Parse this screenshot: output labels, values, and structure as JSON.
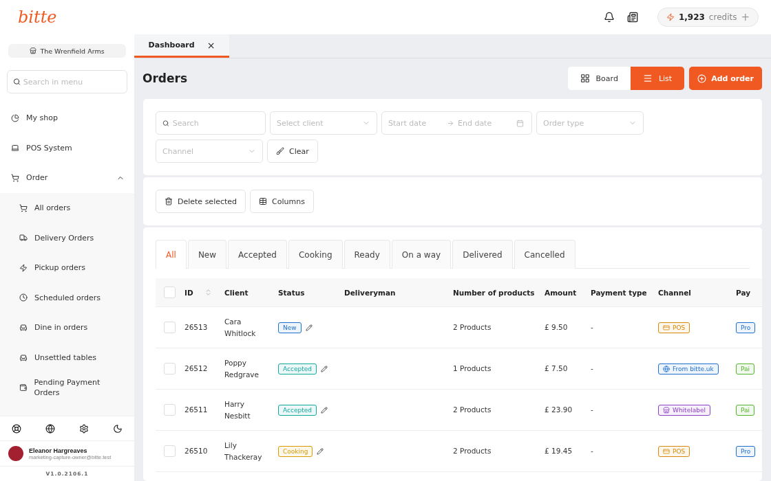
{
  "logo": "bitte",
  "shop": "The Wrenfield Arms",
  "menu_search": {
    "placeholder": "Search in menu"
  },
  "menu": [
    {
      "label": "My shop",
      "kind": "chart"
    },
    {
      "label": "POS System",
      "kind": "laptop"
    },
    {
      "label": "Order",
      "kind": "cart",
      "expanded": true,
      "children": [
        {
          "label": "All orders",
          "kind": "cart"
        },
        {
          "label": "Delivery Orders",
          "kind": "truck"
        },
        {
          "label": "Pickup orders",
          "kind": "bolt"
        },
        {
          "label": "Scheduled orders",
          "kind": "clock"
        },
        {
          "label": "Dine in orders",
          "kind": "table"
        },
        {
          "label": "Unsettled tables",
          "kind": "table"
        },
        {
          "label": "Pending Payment Orders",
          "kind": "wallet"
        }
      ]
    }
  ],
  "user": {
    "name": "Eleanor Hargreaves",
    "email": "marketing-capture-owner@bitte.test"
  },
  "version": "V1.0.2106.1",
  "credits": {
    "amount": "1,923",
    "label": "credits",
    "add": "+"
  },
  "page_tabs": [
    {
      "label": "Dashboard",
      "selected": true,
      "close": "×"
    }
  ],
  "title": "Orders",
  "view_buttons": [
    {
      "label": "Board",
      "selected": false
    },
    {
      "label": "List",
      "selected": true
    }
  ],
  "add_button": "Add order",
  "filters": {
    "search": {
      "placeholder": "Search"
    },
    "client": {
      "placeholder": "Select client"
    },
    "start_date": {
      "placeholder": "Start date"
    },
    "end_date": {
      "placeholder": "End date"
    },
    "order_type": {
      "placeholder": "Order type"
    },
    "channel": {
      "placeholder": "Channel"
    },
    "clear": "Clear"
  },
  "actions": [
    "Delete selected",
    "Columns"
  ],
  "status_tabs": [
    {
      "label": "All",
      "selected": true
    },
    {
      "label": "New",
      "selected": false
    },
    {
      "label": "Accepted",
      "selected": false
    },
    {
      "label": "Cooking",
      "selected": false
    },
    {
      "label": "Ready",
      "selected": false
    },
    {
      "label": "On a way",
      "selected": false
    },
    {
      "label": "Delivered",
      "selected": false
    },
    {
      "label": "Cancelled",
      "selected": false
    }
  ],
  "table": {
    "select_all": false,
    "columns": [
      "ID",
      "Client",
      "Status",
      "Deliveryman",
      "Number of products",
      "Amount",
      "Payment type",
      "Channel",
      "Pay"
    ],
    "rows": [
      {
        "checked": false,
        "id": "26513",
        "client": "Cara Whitlock",
        "status": {
          "label": "New",
          "color": "#1f6fd1"
        },
        "deliveryman": "",
        "products": "2 Products",
        "amount": "£ 9.50",
        "payment_type": "-",
        "channel": {
          "label": "POS",
          "kind": "pos"
        },
        "pay": {
          "label": "Pro",
          "color": "#1f6fd1"
        }
      },
      {
        "checked": false,
        "id": "26512",
        "client": "Poppy Redgrave",
        "status": {
          "label": "Accepted",
          "color": "#13a89e"
        },
        "deliveryman": "",
        "products": "1 Products",
        "amount": "£ 7.50",
        "payment_type": "-",
        "channel": {
          "label": "From bitte.uk",
          "kind": "web"
        },
        "pay": {
          "label": "Pai",
          "color": "#52b52a"
        }
      },
      {
        "checked": false,
        "id": "26511",
        "client": "Harry Nesbitt",
        "status": {
          "label": "Accepted",
          "color": "#13a89e"
        },
        "deliveryman": "",
        "products": "2 Products",
        "amount": "£ 23.90",
        "payment_type": "-",
        "channel": {
          "label": "Whitelabel",
          "kind": "whitelabel"
        },
        "pay": {
          "label": "Pai",
          "color": "#52b52a"
        }
      },
      {
        "checked": false,
        "id": "26510",
        "client": "Lily Thackeray",
        "status": {
          "label": "Cooking",
          "color": "#d99a06"
        },
        "deliveryman": "",
        "products": "2 Products",
        "amount": "£ 19.45",
        "payment_type": "-",
        "channel": {
          "label": "POS",
          "kind": "pos"
        },
        "pay": {
          "label": "Pro",
          "color": "#1f6fd1"
        }
      }
    ]
  }
}
